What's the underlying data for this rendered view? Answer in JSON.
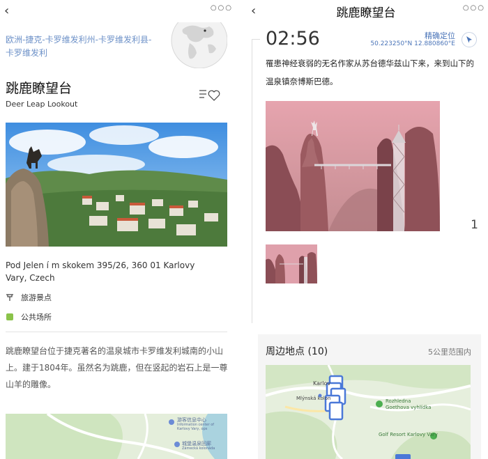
{
  "left": {
    "topbar": {
      "back_icon": "‹",
      "more_icon": "○○○"
    },
    "breadcrumb": "欧洲-捷克-卡罗维发利州-卡罗维发利县-卡罗维发利",
    "title": "跳鹿瞭望台",
    "subtitle": "Deer Leap Lookout",
    "address": "Pod Jelen í m skokem 395/26, 360 01 Karlovy Vary, Czech",
    "category": "旅游景点",
    "tag": "公共场所",
    "description": "跳鹿瞭望台位于捷克著名的温泉城市卡罗维发利城南的小山上。建于1804年。虽然名为跳鹿，但在竖起的岩石上是一尊山羊的雕像。",
    "map_labels": {
      "poi1": "游客信息中心",
      "poi1_sub": "Information center of Karlovy Vary, ops",
      "poi2": "城堡温泉回廊",
      "poi2_sub": "Zámecká kolonáda"
    }
  },
  "right": {
    "topbar": {
      "back_icon": "‹",
      "title": "跳鹿瞭望台",
      "more_icon": "○○○"
    },
    "time": "02:56",
    "locate_label": "精确定位",
    "coords": "50.223250°N 12.880860°E",
    "story": "罹患神经衰弱的无名作家从苏台德华兹山下来，来到山下的温泉镇奈博斯巴德。",
    "photo_count": "1",
    "nearby": {
      "title": "周边地点 (10)",
      "range": "5公里范围内",
      "map_labels": {
        "town": "Karlov",
        "street": "Mlýnská kolon",
        "poi1": "Rozhledna",
        "poi1_sub": "Goethova vyhlídka",
        "poi2": "Golf Resort Karlovy Vary"
      }
    }
  },
  "colors": {
    "link": "#6d91c8",
    "accent": "#4a74b8",
    "tag_green": "#8bc34a",
    "map_marker": "#4a78d8"
  }
}
